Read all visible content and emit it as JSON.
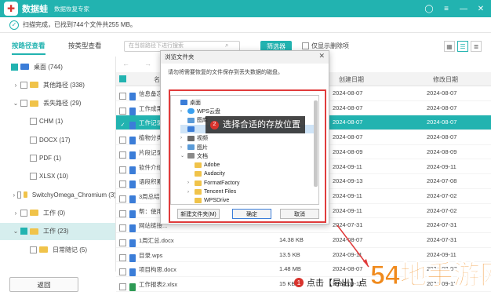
{
  "app": {
    "name": "数据蛙",
    "subtitle": "数据恢复专家",
    "logo_icon": "frog-logo"
  },
  "status": {
    "text": "扫描完成，已找到744个文件共255 MB。"
  },
  "tabs": [
    {
      "label": "按路径查看",
      "active": true
    },
    {
      "label": "按类型查看",
      "active": false
    }
  ],
  "toolbar": {
    "search_placeholder": "在当前路径下进行搜索",
    "filter_label": "筛选器",
    "show_deleted_label": "仅显示删除项"
  },
  "table": {
    "headers": {
      "name": "名",
      "size": "",
      "created": "创建日期",
      "modified": "修改日期"
    },
    "rows": [
      {
        "name": "信息备忘...",
        "size": "",
        "created": "2024-08-07",
        "modified": "2024-08-07",
        "icon": "doc",
        "checked": false
      },
      {
        "name": "工作成果分...",
        "size": "",
        "created": "2024-08-07",
        "modified": "2024-08-07",
        "icon": "doc",
        "checked": false
      },
      {
        "name": "工作记录5...",
        "size": "",
        "created": "2024-08-07",
        "modified": "2024-08-07",
        "icon": "doc",
        "checked": true,
        "selected": true
      },
      {
        "name": "植物分类...",
        "size": "",
        "created": "2024-08-07",
        "modified": "2024-08-07",
        "icon": "doc",
        "checked": false
      },
      {
        "name": "片段记录...",
        "size": "",
        "created": "2024-08-09",
        "modified": "2024-08-09",
        "icon": "doc",
        "checked": false
      },
      {
        "name": "软件介绍...",
        "size": "",
        "created": "2024-09-11",
        "modified": "2024-09-11",
        "icon": "doc",
        "checked": false
      },
      {
        "name": "语段积累...",
        "size": "",
        "created": "2024-09-13",
        "modified": "2024-07-08",
        "icon": "doc",
        "checked": false
      },
      {
        "name": "3周总结.docx",
        "size": "",
        "created": "2024-09-11",
        "modified": "2024-07-02",
        "icon": "doc",
        "checked": false
      },
      {
        "name": "帮：使用...",
        "size": "",
        "created": "2024-09-11",
        "modified": "2024-07-02",
        "icon": "doc",
        "checked": false
      },
      {
        "name": "网站链接...",
        "size": "",
        "created": "2024-07-31",
        "modified": "2024-07-31",
        "icon": "doc",
        "checked": false
      },
      {
        "name": "1周汇总.docx",
        "size": "14.38 KB",
        "created": "2024-08-07",
        "modified": "2024-07-31",
        "icon": "doc",
        "checked": false
      },
      {
        "name": "目录.wps",
        "size": "13.5 KB",
        "created": "2024-09-11",
        "modified": "2024-09-11",
        "icon": "doc",
        "checked": false
      },
      {
        "name": "项目构思.docx",
        "size": "1.48 MB",
        "created": "2024-08-07",
        "modified": "2024-08-07",
        "icon": "doc",
        "checked": false
      },
      {
        "name": "工作报表2.xlsx",
        "size": "15 KB",
        "created": "2024-09-11",
        "modified": "2024-09-11",
        "icon": "xls",
        "checked": false
      }
    ]
  },
  "tree": [
    {
      "label": "桌面 (744)",
      "depth": 0,
      "chevron": "",
      "checkbox": "half",
      "icon": "desktop",
      "selected": false
    },
    {
      "label": "其他路径 (338)",
      "depth": 1,
      "chevron": "›",
      "checkbox": "none",
      "icon": "folder",
      "selected": false
    },
    {
      "label": "丢失路径 (29)",
      "depth": 1,
      "chevron": "⌄",
      "checkbox": "none",
      "icon": "folder",
      "selected": false
    },
    {
      "label": "CHM (1)",
      "depth": 2,
      "chevron": "",
      "checkbox": "none",
      "icon": "none",
      "selected": false
    },
    {
      "label": "DOCX (17)",
      "depth": 2,
      "chevron": "",
      "checkbox": "none",
      "icon": "none",
      "selected": false
    },
    {
      "label": "PDF (1)",
      "depth": 2,
      "chevron": "",
      "checkbox": "none",
      "icon": "none",
      "selected": false
    },
    {
      "label": "XLSX (10)",
      "depth": 2,
      "chevron": "",
      "checkbox": "none",
      "icon": "none",
      "selected": false
    },
    {
      "label": "SwitchyOmega_Chromium (3)",
      "depth": 1,
      "chevron": "›",
      "checkbox": "none",
      "icon": "folder",
      "selected": false
    },
    {
      "label": "工作 (0)",
      "depth": 1,
      "chevron": "›",
      "checkbox": "none",
      "icon": "folder",
      "selected": false
    },
    {
      "label": "工作 (23)",
      "depth": 1,
      "chevron": "⌄",
      "checkbox": "half",
      "icon": "folder",
      "selected": true
    },
    {
      "label": "日常随记 (5)",
      "depth": 2,
      "chevron": "",
      "checkbox": "none",
      "icon": "folder",
      "selected": false
    }
  ],
  "dialog": {
    "title": "浏览文件夹",
    "description": "请勿将需要恢复的文件保存到丢失数据的磁盘。",
    "callout": {
      "badge": "2",
      "text": "选择合适的存放位置"
    },
    "tree": [
      {
        "label": "桌面",
        "depth": 0,
        "chevron": "",
        "icon": "desktop",
        "selected": false
      },
      {
        "label": "WPS云盘",
        "depth": 1,
        "chevron": "›",
        "icon": "cloud",
        "selected": false
      },
      {
        "label": "图库",
        "depth": 1,
        "chevron": "",
        "icon": "img",
        "selected": false
      },
      {
        "label": "",
        "depth": 1,
        "chevron": "",
        "icon": "blue",
        "selected": true
      },
      {
        "label": "视频",
        "depth": 1,
        "chevron": "›",
        "icon": "vid",
        "selected": false
      },
      {
        "label": "图片",
        "depth": 1,
        "chevron": "›",
        "icon": "img",
        "selected": false
      },
      {
        "label": "文档",
        "depth": 1,
        "chevron": "⌄",
        "icon": "doc",
        "selected": false
      },
      {
        "label": "Adobe",
        "depth": 2,
        "chevron": "",
        "icon": "folder",
        "selected": false
      },
      {
        "label": "Audacity",
        "depth": 2,
        "chevron": "",
        "icon": "folder",
        "selected": false
      },
      {
        "label": "FormatFactory",
        "depth": 2,
        "chevron": "›",
        "icon": "folder",
        "selected": false
      },
      {
        "label": "Tencent Files",
        "depth": 2,
        "chevron": "›",
        "icon": "folder",
        "selected": false
      },
      {
        "label": "WPSDrive",
        "depth": 2,
        "chevron": "",
        "icon": "folder",
        "selected": false
      }
    ],
    "buttons": {
      "new_folder": "新建文件夹(M)",
      "ok": "确定",
      "cancel": "取消"
    }
  },
  "bottom": {
    "back_label": "返回",
    "hint_badge": "1",
    "hint_text": "点击【导出】点"
  },
  "watermark": {
    "text": "54地手游网"
  },
  "colors": {
    "teal": "#22b3b0",
    "red": "#e03b3b"
  }
}
